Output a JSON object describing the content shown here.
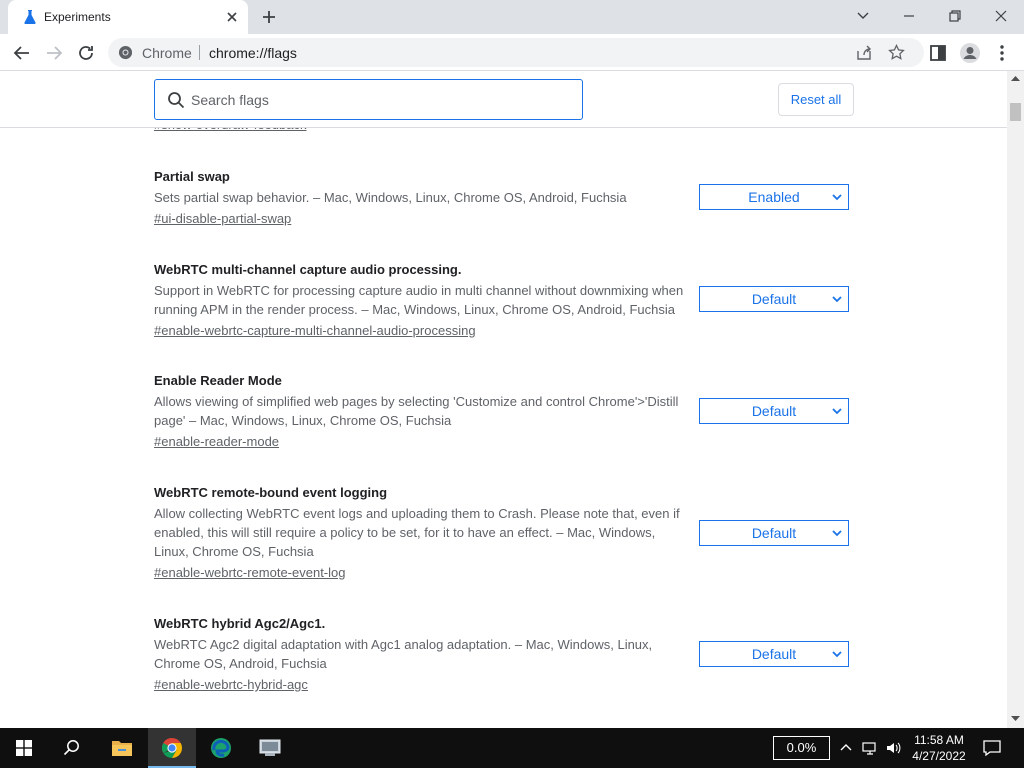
{
  "tab": {
    "title": "Experiments",
    "favicon_icon": "flask-icon",
    "close_icon": "close-icon"
  },
  "new_tab_icon": "plus-icon",
  "window_controls": {
    "chevron_icon": "chevron-down-icon",
    "minimize_icon": "minimize-icon",
    "restore_icon": "restore-icon",
    "close_icon": "close-icon"
  },
  "toolbar": {
    "back_icon": "back-arrow-icon",
    "forward_icon": "forward-arrow-icon",
    "reload_icon": "reload-icon",
    "omnibox_label": "Chrome",
    "url": "chrome://flags",
    "share_icon": "share-icon",
    "bookmark_icon": "star-icon",
    "sidepanel_icon": "side-panel-icon",
    "profile_icon": "profile-icon",
    "menu_icon": "kebab-menu-icon"
  },
  "search": {
    "placeholder": "Search flags",
    "value": ""
  },
  "reset_label": "Reset all",
  "partial_link": "#show-overdraw-feedback",
  "flags": [
    {
      "title": "Partial swap",
      "description": "Sets partial swap behavior. – Mac, Windows, Linux, Chrome OS, Android, Fuchsia",
      "link": "#ui-disable-partial-swap",
      "value": "Enabled"
    },
    {
      "title": "WebRTC multi-channel capture audio processing.",
      "description": "Support in WebRTC for processing capture audio in multi channel without downmixing when running APM in the render process. – Mac, Windows, Linux, Chrome OS, Android, Fuchsia",
      "link": "#enable-webrtc-capture-multi-channel-audio-processing",
      "value": "Default"
    },
    {
      "title": "Enable Reader Mode",
      "description": "Allows viewing of simplified web pages by selecting 'Customize and control Chrome'>'Distill page' – Mac, Windows, Linux, Chrome OS, Fuchsia",
      "link": "#enable-reader-mode",
      "value": "Default"
    },
    {
      "title": "WebRTC remote-bound event logging",
      "description": "Allow collecting WebRTC event logs and uploading them to Crash. Please note that, even if enabled, this will still require a policy to be set, for it to have an effect. – Mac, Windows, Linux, Chrome OS, Fuchsia",
      "link": "#enable-webrtc-remote-event-log",
      "value": "Default"
    },
    {
      "title": "WebRTC hybrid Agc2/Agc1.",
      "description": "WebRTC Agc2 digital adaptation with Agc1 analog adaptation. – Mac, Windows, Linux, Chrome OS, Android, Fuchsia",
      "link": "#enable-webrtc-hybrid-agc",
      "value": "Default"
    }
  ],
  "taskbar": {
    "start_icon": "windows-start-icon",
    "search_icon": "search-icon",
    "apps": [
      "file-explorer-icon",
      "chrome-icon",
      "edge-icon",
      "network-app-icon"
    ],
    "perf_label": "0.0%",
    "tray_icons": [
      "chevron-up-icon",
      "network-icon",
      "volume-icon"
    ],
    "time": "11:58 AM",
    "date": "4/27/2022",
    "notification_icon": "notification-icon"
  }
}
